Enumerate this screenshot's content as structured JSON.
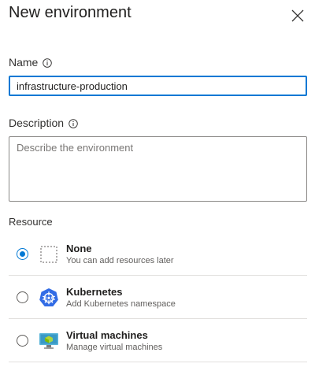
{
  "header": {
    "title": "New environment",
    "close_icon": "close-icon"
  },
  "form": {
    "name": {
      "label": "Name",
      "value": "infrastructure-production",
      "info_icon": "info-icon"
    },
    "description": {
      "label": "Description",
      "placeholder": "Describe the environment",
      "value": "",
      "info_icon": "info-icon"
    },
    "resource": {
      "label": "Resource",
      "selected": "None",
      "options": [
        {
          "title": "None",
          "subtitle": "You can add resources later",
          "icon": "dotted-square-icon",
          "checked": true
        },
        {
          "title": "Kubernetes",
          "subtitle": "Add Kubernetes namespace",
          "icon": "kubernetes-icon",
          "checked": false
        },
        {
          "title": "Virtual machines",
          "subtitle": "Manage virtual machines",
          "icon": "virtual-machine-icon",
          "checked": false
        }
      ]
    }
  },
  "colors": {
    "accent": "#0078d4",
    "kubernetes": "#326ce5"
  }
}
